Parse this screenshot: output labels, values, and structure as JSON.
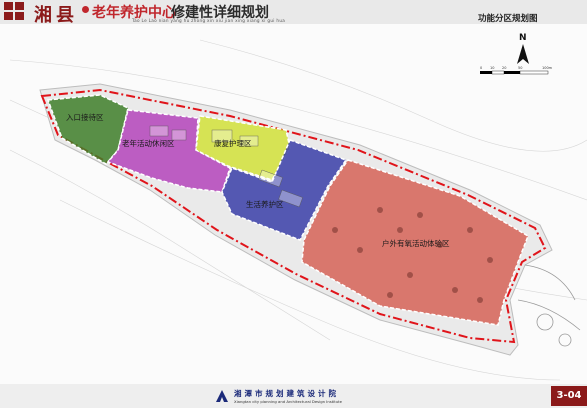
{
  "header": {
    "brand_char_1": "湘",
    "brand_char_2": "县",
    "title_red": "老年养护中心",
    "title_dark": "修建性详细规划",
    "pinyin": "Tao Le Lao nian yang hu zhong xin xiu jian xing xiang xi gui hua",
    "sheet_title": "功能分区规划图"
  },
  "north_arrow": {
    "label": "N"
  },
  "scale_bar": {
    "ticks": [
      "0",
      "10",
      "20",
      "50",
      "100m"
    ]
  },
  "zones": [
    {
      "label": "入口接待区",
      "color": "#3f7f2a"
    },
    {
      "label": "老年活动休闲区",
      "color": "#b03ab8"
    },
    {
      "label": "康复护理区",
      "color": "#d2e23a"
    },
    {
      "label": "生活养护区",
      "color": "#3a3ea8"
    },
    {
      "label": "户外有氧活动体验区",
      "color": "#d45a4e"
    }
  ],
  "footer": {
    "institute_name": "湘潭市规划建筑设计院",
    "institute_en": "Xiangtan city planning and Architectural Design Institute",
    "page_number": "3-04"
  }
}
